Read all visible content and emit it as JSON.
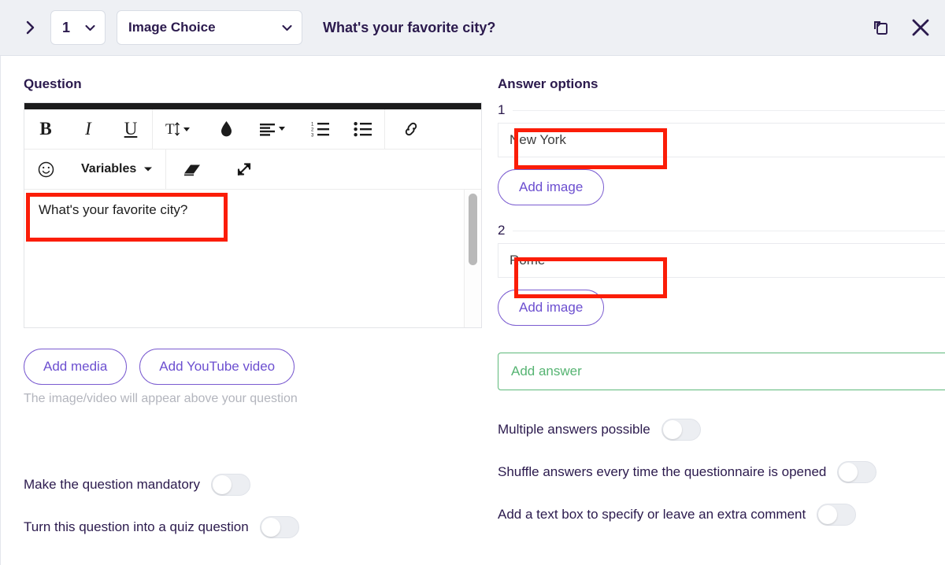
{
  "header": {
    "expand_icon": "chevron-right-icon",
    "question_number": "1",
    "question_type": "Image Choice",
    "title": "What's your favorite city?",
    "duplicate_icon": "duplicate-icon",
    "close_icon": "close-icon"
  },
  "question_panel": {
    "title": "Question",
    "toolbar": {
      "bold": "B",
      "italic": "I",
      "underline": "U",
      "font_size_icon": "text-size-icon",
      "color_icon": "color-droplet-icon",
      "align_icon": "align-left-icon",
      "ordered_list_icon": "ordered-list-icon",
      "bullet_list_icon": "bullet-list-icon",
      "link_icon": "link-icon",
      "emoji_icon": "emoji-smiley-icon",
      "variables_label": "Variables",
      "eraser_icon": "eraser-icon",
      "expand_icon": "fullscreen-expand-icon"
    },
    "editor_text": "What's your favorite city?",
    "add_media_label": "Add media",
    "add_youtube_label": "Add YouTube video",
    "media_hint": "The image/video will appear above your question",
    "toggles": [
      {
        "label": "Make the question mandatory",
        "on": false
      },
      {
        "label": "Turn this question into a quiz question",
        "on": false
      }
    ]
  },
  "answers_panel": {
    "title": "Answer options",
    "options": [
      {
        "number": "1",
        "value": "New York",
        "add_image_label": "Add image"
      },
      {
        "number": "2",
        "value": "Rome",
        "add_image_label": "Add image"
      }
    ],
    "add_answer_placeholder": "Add answer",
    "add_answer_plus": "+",
    "toggles": [
      {
        "label": "Multiple answers possible",
        "on": false
      },
      {
        "label": "Shuffle answers every time the questionnaire is opened",
        "on": false
      },
      {
        "label": "Add a text box to specify or leave an extra comment",
        "on": false
      }
    ]
  },
  "colors": {
    "header_bg": "#eef0f4",
    "text_primary": "#2b1a4d",
    "accent_purple": "#6c4fd0",
    "accent_green": "#56b472",
    "annotation_red": "#fb1d08"
  }
}
